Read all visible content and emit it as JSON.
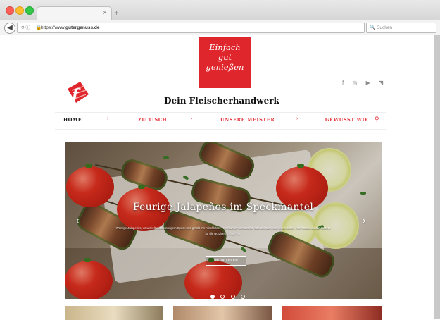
{
  "browser": {
    "url_prefix": "https://www.",
    "url_domain": "gutergenuss.de",
    "search_placeholder": "Suchen",
    "url_icons": "⟲ ⓘ",
    "reload_icon": "↻",
    "back_icon": "◀",
    "close_tab_icon": "×",
    "new_tab_icon": "+",
    "search_icon": "🔍"
  },
  "site": {
    "logo_lines": [
      "Einfach",
      "gut",
      "genießen"
    ],
    "f_logo_letter": "f",
    "tagline": "Dein Fleischerhandwerk",
    "social_icons": [
      "facebook-icon",
      "instagram-icon",
      "youtube-icon",
      "rss-icon"
    ],
    "social_glyphs": "f ◎ ▶ ◥",
    "menu": {
      "items": [
        {
          "label": "HOME",
          "active": true
        },
        {
          "label": "ZU TISCH"
        },
        {
          "label": "UNSERE MEISTER"
        },
        {
          "label": "GEWUSST WIE"
        }
      ],
      "separator": "›",
      "search_glyph": "⚲"
    },
    "slider": {
      "title": "Feurige Jalapeños im Speckmantel",
      "text": "Würzige Jalapeños, umwickelt mit knusprigem Speck und gefüllt mit Frischkäse – ein feuriger Genuss für jede Grillparty und jedes Buffet. Hier findest du das Rezept für die würzigen Jalapeños.",
      "button": "MEHR LESEN",
      "arrow_left": "‹",
      "arrow_right": "›",
      "dots": 4,
      "active_dot": 0
    }
  },
  "colors": {
    "brand_red": "#e0262d",
    "menu_red": "#e4393f"
  }
}
